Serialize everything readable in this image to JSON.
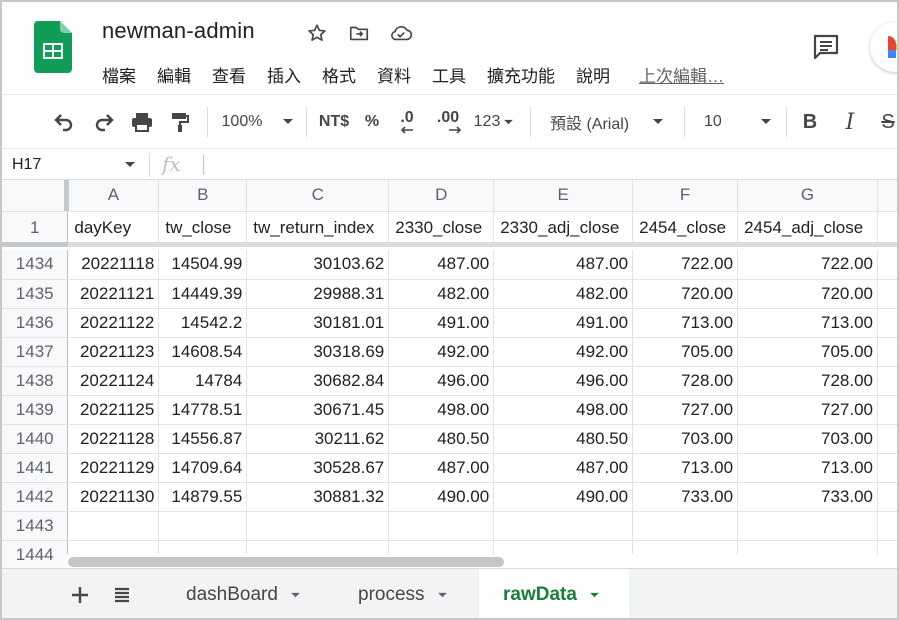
{
  "app": {
    "title": "newman-admin",
    "menu": [
      "檔案",
      "編輯",
      "查看",
      "插入",
      "格式",
      "資料",
      "工具",
      "擴充功能",
      "說明"
    ],
    "last_edit": "上次編輯…"
  },
  "toolbar": {
    "zoom": "100%",
    "currency": "NT$",
    "percent": "%",
    "decrease_decimal": ".0",
    "increase_decimal": ".00",
    "more_formats": "123",
    "font": "預設 (Arial)",
    "font_size": "10",
    "bold": "B",
    "italic": "I",
    "strike": "S"
  },
  "formula_bar": {
    "name_box": "H17",
    "fx": "fx",
    "value": ""
  },
  "columns": [
    "A",
    "B",
    "C",
    "D",
    "E",
    "F",
    "G"
  ],
  "header_row": {
    "row_number": "1",
    "cells": [
      "dayKey",
      "tw_close",
      "tw_return_index",
      "2330_close",
      "2330_adj_close",
      "2454_close",
      "2454_adj_close"
    ]
  },
  "rows": [
    {
      "n": "1434",
      "cells": [
        "20221118",
        "14504.99",
        "30103.62",
        "487.00",
        "487.00",
        "722.00",
        "722.00"
      ]
    },
    {
      "n": "1435",
      "cells": [
        "20221121",
        "14449.39",
        "29988.31",
        "482.00",
        "482.00",
        "720.00",
        "720.00"
      ]
    },
    {
      "n": "1436",
      "cells": [
        "20221122",
        "14542.2",
        "30181.01",
        "491.00",
        "491.00",
        "713.00",
        "713.00"
      ]
    },
    {
      "n": "1437",
      "cells": [
        "20221123",
        "14608.54",
        "30318.69",
        "492.00",
        "492.00",
        "705.00",
        "705.00"
      ]
    },
    {
      "n": "1438",
      "cells": [
        "20221124",
        "14784",
        "30682.84",
        "496.00",
        "496.00",
        "728.00",
        "728.00"
      ]
    },
    {
      "n": "1439",
      "cells": [
        "20221125",
        "14778.51",
        "30671.45",
        "498.00",
        "498.00",
        "727.00",
        "727.00"
      ]
    },
    {
      "n": "1440",
      "cells": [
        "20221128",
        "14556.87",
        "30211.62",
        "480.50",
        "480.50",
        "703.00",
        "703.00"
      ]
    },
    {
      "n": "1441",
      "cells": [
        "20221129",
        "14709.64",
        "30528.67",
        "487.00",
        "487.00",
        "713.00",
        "713.00"
      ]
    },
    {
      "n": "1442",
      "cells": [
        "20221130",
        "14879.55",
        "30881.32",
        "490.00",
        "490.00",
        "733.00",
        "733.00"
      ]
    },
    {
      "n": "1443",
      "cells": [
        "",
        "",
        "",
        "",
        "",
        "",
        ""
      ]
    },
    {
      "n": "1444",
      "cells": [
        "",
        "",
        "",
        "",
        "",
        "",
        ""
      ]
    }
  ],
  "sheet_tabs": [
    {
      "label": "dashBoard",
      "active": false
    },
    {
      "label": "process",
      "active": false
    },
    {
      "label": "rawData",
      "active": true
    }
  ],
  "colors": {
    "sheets_green": "#0f9d58",
    "active_tab": "#188038",
    "header_bg": "#f8f9fa",
    "gridline": "#e2e3e3"
  },
  "icons": {
    "undo": "undo-icon",
    "redo": "redo-icon",
    "print": "print-icon",
    "paint": "paint-format-icon",
    "star": "star-icon",
    "move": "move-to-folder-icon",
    "cloud": "cloud-status-icon",
    "comment": "comment-icon",
    "add_sheet": "plus-icon",
    "sheet_list": "list-icon"
  }
}
